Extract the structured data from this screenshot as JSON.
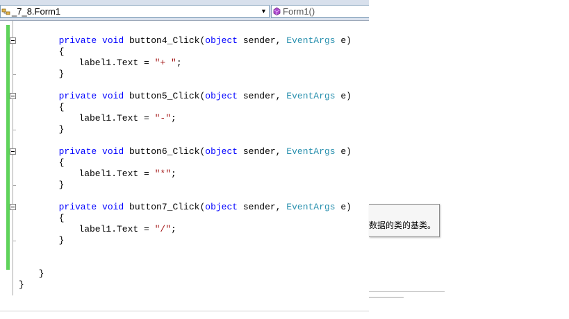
{
  "navbar": {
    "class_combo": {
      "text": "_7_8.Form1",
      "icon": "class-icon"
    },
    "member_combo": {
      "text": "Form1()",
      "icon": "method-icon"
    }
  },
  "code": {
    "lines": [
      {
        "indent": 8,
        "tokens": [
          {
            "t": "private",
            "c": "kw"
          },
          {
            "t": " "
          },
          {
            "t": "void",
            "c": "kw"
          },
          {
            "t": " button4_Click("
          },
          {
            "t": "object",
            "c": "kw"
          },
          {
            "t": " sender, "
          },
          {
            "t": "EventArgs",
            "c": "ty"
          },
          {
            "t": " e)"
          }
        ]
      },
      {
        "indent": 8,
        "tokens": [
          {
            "t": "{"
          }
        ]
      },
      {
        "indent": 12,
        "tokens": [
          {
            "t": "label1.Text = "
          },
          {
            "t": "\"+ \"",
            "c": "str"
          },
          {
            "t": ";"
          }
        ]
      },
      {
        "indent": 8,
        "tokens": [
          {
            "t": "}"
          }
        ]
      },
      {
        "indent": 0,
        "tokens": []
      },
      {
        "indent": 8,
        "tokens": [
          {
            "t": "private",
            "c": "kw"
          },
          {
            "t": " "
          },
          {
            "t": "void",
            "c": "kw"
          },
          {
            "t": " button5_Click("
          },
          {
            "t": "object",
            "c": "kw"
          },
          {
            "t": " sender, "
          },
          {
            "t": "EventArgs",
            "c": "ty"
          },
          {
            "t": " e)"
          }
        ]
      },
      {
        "indent": 8,
        "tokens": [
          {
            "t": "{"
          }
        ]
      },
      {
        "indent": 12,
        "tokens": [
          {
            "t": "label1.Text = "
          },
          {
            "t": "\"-\"",
            "c": "str"
          },
          {
            "t": ";"
          }
        ]
      },
      {
        "indent": 8,
        "tokens": [
          {
            "t": "}"
          }
        ]
      },
      {
        "indent": 0,
        "tokens": []
      },
      {
        "indent": 8,
        "tokens": [
          {
            "t": "private",
            "c": "kw"
          },
          {
            "t": " "
          },
          {
            "t": "void",
            "c": "kw"
          },
          {
            "t": " button6_Click("
          },
          {
            "t": "object",
            "c": "kw"
          },
          {
            "t": " sender, "
          },
          {
            "t": "EventArgs",
            "c": "ty"
          },
          {
            "t": " e)"
          }
        ]
      },
      {
        "indent": 8,
        "tokens": [
          {
            "t": "{"
          }
        ]
      },
      {
        "indent": 12,
        "tokens": [
          {
            "t": "label1.Text = "
          },
          {
            "t": "\"*\"",
            "c": "str"
          },
          {
            "t": ";"
          }
        ]
      },
      {
        "indent": 8,
        "tokens": [
          {
            "t": "}"
          }
        ]
      },
      {
        "indent": 0,
        "tokens": []
      },
      {
        "indent": 8,
        "tokens": [
          {
            "t": "private",
            "c": "kw"
          },
          {
            "t": " "
          },
          {
            "t": "void",
            "c": "kw"
          },
          {
            "t": " button7_Click("
          },
          {
            "t": "object",
            "c": "kw"
          },
          {
            "t": " sender, "
          },
          {
            "t": "EventArgs",
            "c": "ty"
          },
          {
            "t": " e)"
          }
        ]
      },
      {
        "indent": 8,
        "tokens": [
          {
            "t": "{"
          }
        ]
      },
      {
        "indent": 12,
        "tokens": [
          {
            "t": "label1.Text = "
          },
          {
            "t": "\"/\"",
            "c": "str"
          },
          {
            "t": ";"
          }
        ]
      },
      {
        "indent": 8,
        "tokens": [
          {
            "t": "}"
          }
        ]
      },
      {
        "indent": 0,
        "tokens": []
      },
      {
        "indent": 0,
        "tokens": []
      },
      {
        "indent": 4,
        "tokens": [
          {
            "t": "}"
          }
        ]
      },
      {
        "indent": 0,
        "tokens": [
          {
            "t": "}"
          }
        ]
      }
    ]
  },
  "tooltip": {
    "text": "数据的类的基类。"
  },
  "colors": {
    "keyword": "#0000ff",
    "type": "#2b91af",
    "string": "#a31515",
    "change_bar": "#5fd35b"
  }
}
